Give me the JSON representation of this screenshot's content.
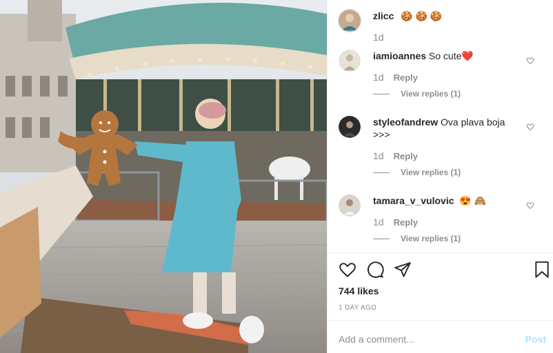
{
  "post": {
    "author": "zlicc",
    "caption_emoji": "🍪 🍪 🍪",
    "age": "1d"
  },
  "comments": [
    {
      "user": "iamioannes",
      "text": "So cute",
      "emoji": "❤️",
      "age": "1d",
      "reply_label": "Reply",
      "view_replies": "View replies (1)"
    },
    {
      "user": "styleofandrew",
      "text": "Ova plava boja >>>",
      "emoji": "",
      "age": "1d",
      "reply_label": "Reply",
      "view_replies": "View replies (1)"
    },
    {
      "user": "tamara_v_vulovic",
      "text": "",
      "emoji": "😍 🙈",
      "age": "1d",
      "reply_label": "Reply",
      "view_replies": "View replies (1)"
    }
  ],
  "likes": "744 likes",
  "date": "1 DAY AGO",
  "comment_box": {
    "placeholder": "Add a comment...",
    "post_label": "Post"
  },
  "icons": [
    "heart-icon",
    "comment-icon",
    "share-icon",
    "bookmark-icon",
    "small-heart-icon"
  ],
  "colors": {
    "accent_disabled": "#b2dffc",
    "muted": "#8e8e8e",
    "text": "#262626",
    "divider": "#efefef"
  }
}
